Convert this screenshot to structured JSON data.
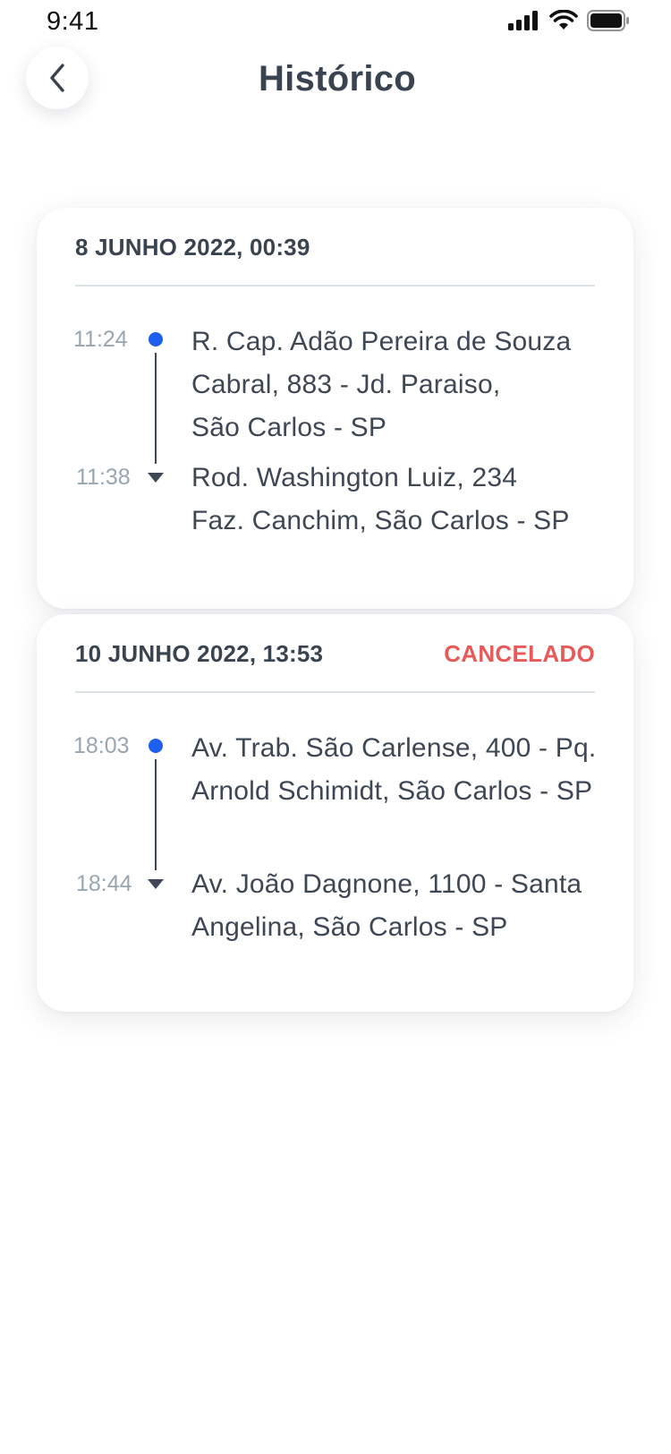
{
  "status_bar": {
    "time": "9:41"
  },
  "header": {
    "title": "Histórico"
  },
  "trips": [
    {
      "date": "8 JUNHO 2022, 00:39",
      "status": "",
      "start": {
        "time": "11:24",
        "address": "R. Cap. Adão Pereira de Souza\nCabral, 883 - Jd. Paraiso,\nSão Carlos - SP"
      },
      "end": {
        "time": "11:38",
        "address": "Rod. Washington Luiz, 234\nFaz. Canchim, São Carlos - SP"
      }
    },
    {
      "date": "10 JUNHO 2022, 13:53",
      "status": "CANCELADO",
      "start": {
        "time": "18:03",
        "address": "Av. Trab. São Carlense, 400 - Pq.\nArnold Schimidt, São Carlos - SP"
      },
      "end": {
        "time": "18:44",
        "address": "Av. João Dagnone, 1100 - Santa\nAngelina, São Carlos - SP"
      }
    }
  ],
  "colors": {
    "accent": "#1f5ff0",
    "cancel": "#e85a5a",
    "text": "#3a4350",
    "muted": "#98a6b0"
  }
}
